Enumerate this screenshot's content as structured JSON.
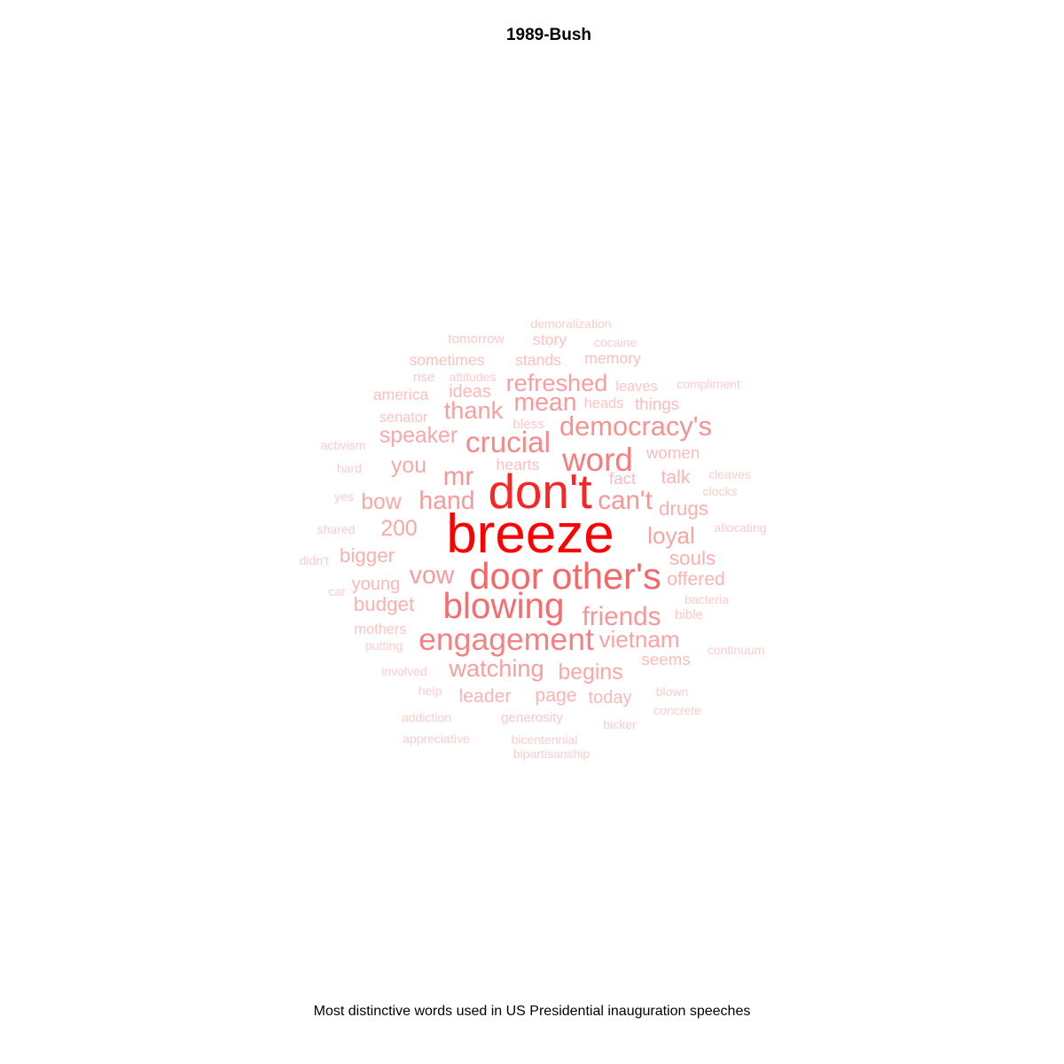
{
  "chart_data": {
    "type": "wordcloud",
    "title": "1989-Bush",
    "caption": "Most distinctive words used in US Presidential inauguration speeches",
    "color_scale": {
      "low": "#ffcccc",
      "mid": "#f4797a",
      "high": "#ff0000"
    },
    "words": [
      {
        "word": "breeze",
        "weight": 1.0
      },
      {
        "word": "don't",
        "weight": 0.88
      },
      {
        "word": "door",
        "weight": 0.66
      },
      {
        "word": "other's",
        "weight": 0.66
      },
      {
        "word": "blowing",
        "weight": 0.64
      },
      {
        "word": "word",
        "weight": 0.58
      },
      {
        "word": "engagement",
        "weight": 0.56
      },
      {
        "word": "crucial",
        "weight": 0.52
      },
      {
        "word": "democracy's",
        "weight": 0.48
      },
      {
        "word": "friends",
        "weight": 0.46
      },
      {
        "word": "mr",
        "weight": 0.46
      },
      {
        "word": "can't",
        "weight": 0.46
      },
      {
        "word": "mean",
        "weight": 0.44
      },
      {
        "word": "vow",
        "weight": 0.44
      },
      {
        "word": "hand",
        "weight": 0.44
      },
      {
        "word": "refreshed",
        "weight": 0.42
      },
      {
        "word": "thank",
        "weight": 0.42
      },
      {
        "word": "watching",
        "weight": 0.42
      },
      {
        "word": "loyal",
        "weight": 0.4
      },
      {
        "word": "vietnam",
        "weight": 0.4
      },
      {
        "word": "speaker",
        "weight": 0.38
      },
      {
        "word": "200",
        "weight": 0.38
      },
      {
        "word": "you",
        "weight": 0.38
      },
      {
        "word": "bow",
        "weight": 0.38
      },
      {
        "word": "begins",
        "weight": 0.38
      },
      {
        "word": "budget",
        "weight": 0.34
      },
      {
        "word": "bigger",
        "weight": 0.34
      },
      {
        "word": "drugs",
        "weight": 0.34
      },
      {
        "word": "souls",
        "weight": 0.34
      },
      {
        "word": "offered",
        "weight": 0.32
      },
      {
        "word": "talk",
        "weight": 0.32
      },
      {
        "word": "leader",
        "weight": 0.32
      },
      {
        "word": "page",
        "weight": 0.32
      },
      {
        "word": "today",
        "weight": 0.3
      },
      {
        "word": "young",
        "weight": 0.3
      },
      {
        "word": "ideas",
        "weight": 0.3
      },
      {
        "word": "women",
        "weight": 0.28
      },
      {
        "word": "things",
        "weight": 0.28
      },
      {
        "word": "seems",
        "weight": 0.28
      },
      {
        "word": "fact",
        "weight": 0.28
      },
      {
        "word": "hearts",
        "weight": 0.26
      },
      {
        "word": "memory",
        "weight": 0.26
      },
      {
        "word": "stands",
        "weight": 0.26
      },
      {
        "word": "sometimes",
        "weight": 0.26
      },
      {
        "word": "story",
        "weight": 0.26
      },
      {
        "word": "america",
        "weight": 0.26
      },
      {
        "word": "mothers",
        "weight": 0.24
      },
      {
        "word": "senator",
        "weight": 0.24
      },
      {
        "word": "heads",
        "weight": 0.24
      },
      {
        "word": "leaves",
        "weight": 0.24
      },
      {
        "word": "bible",
        "weight": 0.22
      },
      {
        "word": "bless",
        "weight": 0.22
      },
      {
        "word": "generosity",
        "weight": 0.22
      },
      {
        "word": "tomorrow",
        "weight": 0.22
      },
      {
        "word": "rise",
        "weight": 0.22
      },
      {
        "word": "demoralization",
        "weight": 0.2
      },
      {
        "word": "cocaine",
        "weight": 0.2
      },
      {
        "word": "attitudes",
        "weight": 0.2
      },
      {
        "word": "compliment",
        "weight": 0.2
      },
      {
        "word": "activism",
        "weight": 0.2
      },
      {
        "word": "hard",
        "weight": 0.2
      },
      {
        "word": "cleaves",
        "weight": 0.2
      },
      {
        "word": "clocks",
        "weight": 0.2
      },
      {
        "word": "yes",
        "weight": 0.2
      },
      {
        "word": "shared",
        "weight": 0.2
      },
      {
        "word": "allocating",
        "weight": 0.2
      },
      {
        "word": "didn't",
        "weight": 0.2
      },
      {
        "word": "car",
        "weight": 0.2
      },
      {
        "word": "bacteria",
        "weight": 0.2
      },
      {
        "word": "putting",
        "weight": 0.2
      },
      {
        "word": "continuum",
        "weight": 0.2
      },
      {
        "word": "involved",
        "weight": 0.2
      },
      {
        "word": "help",
        "weight": 0.2
      },
      {
        "word": "blown",
        "weight": 0.2
      },
      {
        "word": "addiction",
        "weight": 0.2
      },
      {
        "word": "concrete",
        "weight": 0.2
      },
      {
        "word": "bicker",
        "weight": 0.2
      },
      {
        "word": "appreciative",
        "weight": 0.2
      },
      {
        "word": "bicentennial",
        "weight": 0.2
      },
      {
        "word": "bipartisanship",
        "weight": 0.2
      }
    ]
  }
}
